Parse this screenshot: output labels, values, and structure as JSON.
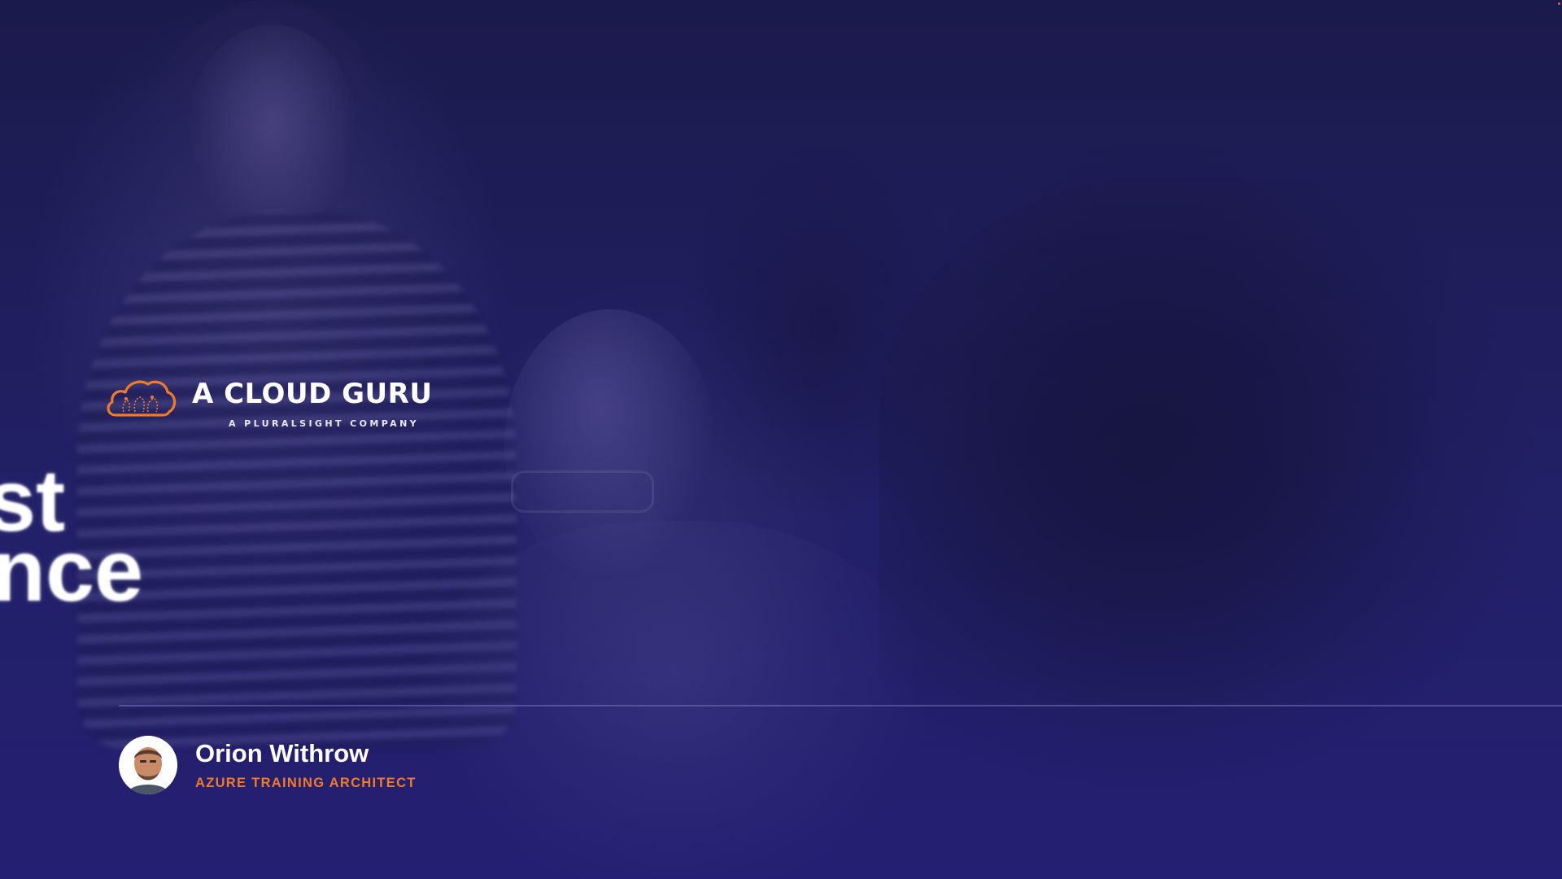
{
  "brand": {
    "name": "A CLOUD GURU",
    "tagline": "A PLURALSIGHT COMPANY",
    "accent_color": "#f07b2a",
    "logo_icon": "cloud-logo-icon"
  },
  "hero": {
    "line1": "st",
    "line2": "nce"
  },
  "presenter": {
    "name": "Orion Withrow",
    "title": "AZURE TRAINING ARCHITECT",
    "avatar_icon": "presenter-avatar"
  },
  "colors": {
    "background": "#1b1a4f",
    "title_accent": "#f07b2a",
    "text": "#ffffff"
  }
}
